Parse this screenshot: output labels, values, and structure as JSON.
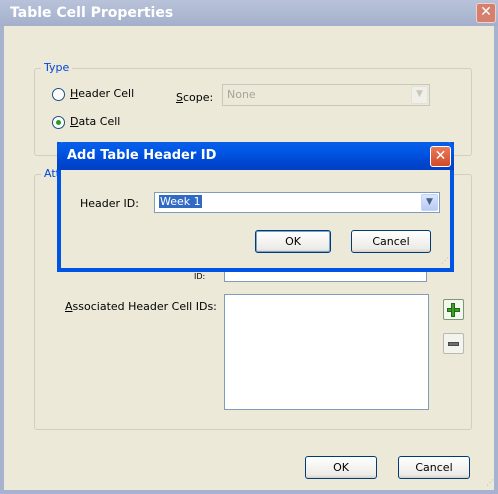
{
  "window": {
    "title": "Table Cell Properties",
    "close_glyph": "✕"
  },
  "type_group": {
    "legend": "Type",
    "header_cell": {
      "prefix": "",
      "accel": "H",
      "rest": "eader Cell",
      "checked": false
    },
    "data_cell": {
      "prefix": "",
      "accel": "D",
      "rest": "ata Cell",
      "checked": true
    },
    "scope_label": {
      "accel": "S",
      "rest": "cope:"
    },
    "scope_value": "None"
  },
  "attributes_group": {
    "legend_visible": "Att",
    "id_label_visible": "ID:",
    "assoc_label": {
      "accel": "A",
      "rest": "ssociated Header Cell IDs:"
    },
    "associated_ids": []
  },
  "footer": {
    "ok": "OK",
    "cancel": "Cancel"
  },
  "modal": {
    "title": "Add Table Header ID",
    "close_glyph": "✕",
    "field_label": "Header ID:",
    "field_value": "Week 1",
    "ok": "OK",
    "cancel": "Cancel"
  },
  "icons": {
    "add": "plus-icon",
    "remove": "minus-icon",
    "dropdown": "chevron-down-icon",
    "grip": "resize-grip-icon"
  },
  "colors": {
    "xp_blue": "#0054e3",
    "legend_blue": "#0046d5",
    "dialog_face": "#ece9d8",
    "selection": "#316ac5"
  }
}
